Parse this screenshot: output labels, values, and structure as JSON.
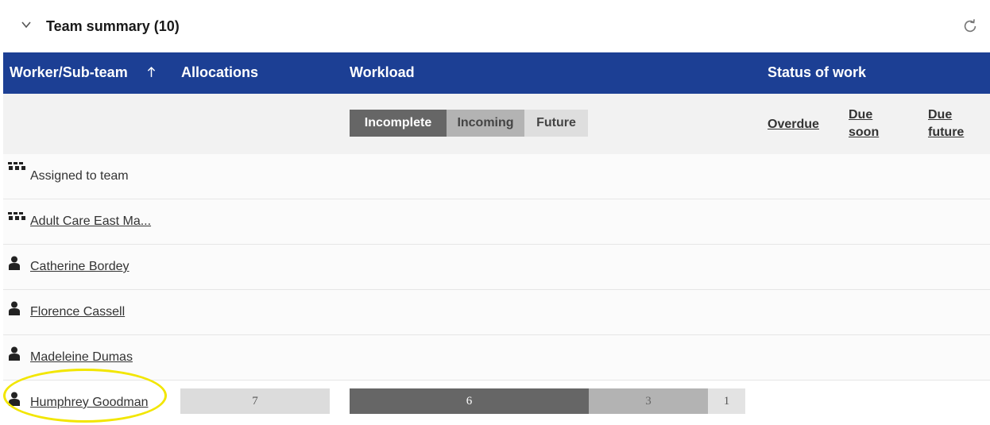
{
  "summary": {
    "title": "Team summary (10)",
    "collapse_icon": "chevron-down-icon",
    "refresh_icon": "refresh-icon"
  },
  "columns": {
    "worker": "Worker/Sub-team",
    "sort_icon": "arrow-up-icon",
    "allocations": "Allocations",
    "workload": "Workload",
    "status": "Status of work"
  },
  "workload_filters": [
    "Incomplete",
    "Incoming",
    "Future"
  ],
  "status_links": {
    "overdue": [
      "Overdue"
    ],
    "due_soon": [
      "Due",
      "soon"
    ],
    "due_future": [
      "Due",
      "future"
    ]
  },
  "rows": [
    {
      "label": "Assigned to team",
      "icon": "team-icon",
      "link": false
    },
    {
      "label": "Adult Care East Ma...",
      "icon": "team-icon",
      "link": true
    },
    {
      "label": "Catherine Bordey",
      "icon": "person-icon",
      "link": true
    },
    {
      "label": "Florence Cassell",
      "icon": "person-icon",
      "link": true
    },
    {
      "label": "Madeleine Dumas",
      "icon": "person-icon",
      "link": true
    },
    {
      "label": "Humphrey Goodman",
      "icon": "person-icon",
      "link": true
    }
  ],
  "humphrey": {
    "allocations": "7",
    "incomplete": "6",
    "incoming": "3",
    "future": "1"
  },
  "colors": {
    "header": "#1c3f94",
    "incomplete": "#666666",
    "incoming": "#b3b3b3",
    "future": "#dedede",
    "highlight": "#f2e600"
  }
}
